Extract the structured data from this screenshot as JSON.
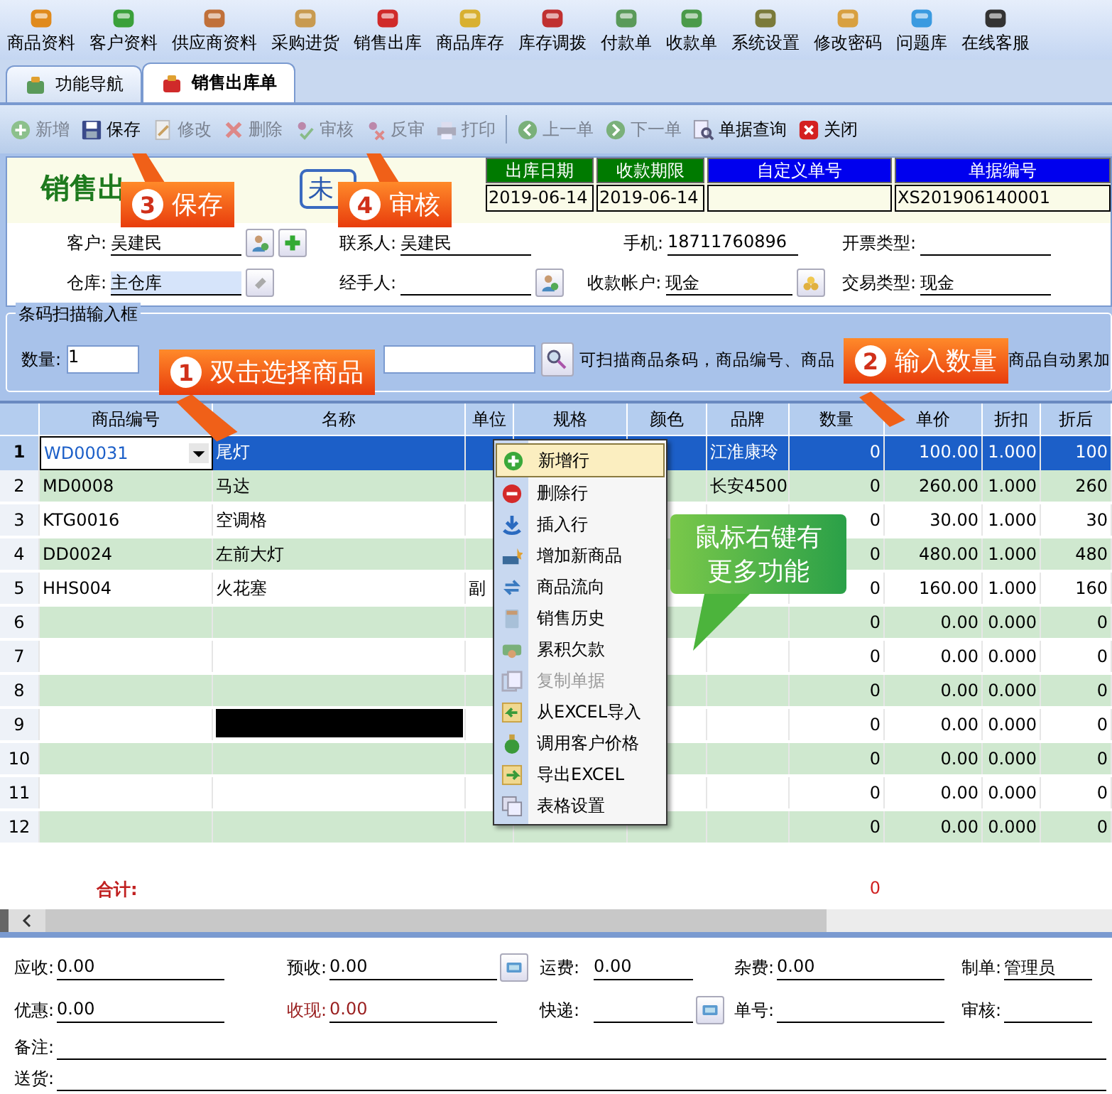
{
  "menu_bar": [
    "商品资料",
    "客户资料",
    "供应商资料",
    "采购进货",
    "销售出库",
    "商品库存",
    "库存调拨",
    "付款单",
    "收款单",
    "系统设置",
    "修改密码",
    "问题库",
    "在线客服"
  ],
  "tabs": [
    {
      "label": "功能导航",
      "selected": false
    },
    {
      "label": "销售出库单",
      "selected": true
    }
  ],
  "toolbar": [
    {
      "label": "新增",
      "kind": "plus",
      "disabled": true
    },
    {
      "label": "保存",
      "kind": "disk",
      "disabled": false
    },
    {
      "label": "修改",
      "kind": "pencil",
      "disabled": true
    },
    {
      "label": "删除",
      "kind": "cross",
      "disabled": true
    },
    {
      "label": "审核",
      "kind": "check",
      "disabled": true
    },
    {
      "label": "反审",
      "kind": "uncheck",
      "disabled": true
    },
    {
      "label": "打印",
      "kind": "printer",
      "disabled": true
    },
    {
      "label": "上一单",
      "kind": "left",
      "disabled": true
    },
    {
      "label": "下一单",
      "kind": "right",
      "disabled": true
    },
    {
      "label": "单据查询",
      "kind": "search",
      "disabled": false
    },
    {
      "label": "关闭",
      "kind": "close",
      "disabled": false
    }
  ],
  "form_title": "销售出",
  "stamp": "未",
  "header_fields": [
    {
      "label": "出库日期",
      "value": "2019-06-14",
      "color": "#007a00"
    },
    {
      "label": "收款期限",
      "value": "2019-06-14",
      "color": "#007a00"
    },
    {
      "label": "自定义单号",
      "color": "#0000ee"
    },
    {
      "label": "单据编号",
      "value": "XS201906140001",
      "color": "#0000ee"
    }
  ],
  "form_rows": [
    [
      {
        "label": "客户:",
        "value": "吴建民",
        "focused": false,
        "kind": "customer"
      },
      {
        "label": "联系人:",
        "value": "吴建民",
        "focused": false,
        "kind": "plain"
      },
      {
        "label": "手机:",
        "value": "18711760896",
        "focused": false,
        "kind": "plain"
      },
      {
        "label": "开票类型:",
        "focused": false,
        "kind": "plain"
      }
    ],
    [
      {
        "label": "仓库:",
        "value": "主仓库",
        "focused": true,
        "kind": "warehouse"
      },
      {
        "label": "经手人:",
        "focused": false,
        "kind": "staff"
      },
      {
        "label": "收款帐户:",
        "value": "现金",
        "focused": false,
        "kind": "account"
      },
      {
        "label": "交易类型:",
        "value": "现金",
        "focused": false,
        "kind": "plain"
      }
    ]
  ],
  "barcode": {
    "legend": "条码扫描输入框",
    "quantity_label": "数量:",
    "quantity": "1",
    "hint_parts": [
      "可扫描商品条码，商品编号、商品",
      "商品自动累加"
    ]
  },
  "table": {
    "columns": [
      {
        "kind": "index"
      },
      {
        "label": "商品编号",
        "kind": "text"
      },
      {
        "label": "名称",
        "kind": "text"
      },
      {
        "label": "单位",
        "kind": "text"
      },
      {
        "label": "规格",
        "kind": "text"
      },
      {
        "label": "颜色",
        "kind": "text"
      },
      {
        "label": "品牌",
        "kind": "text"
      },
      {
        "label": "数量",
        "kind": "number"
      },
      {
        "label": "单价",
        "kind": "number"
      },
      {
        "label": "折扣",
        "kind": "number"
      },
      {
        "label": "折后",
        "kind": "number"
      }
    ],
    "rows": [
      {
        "selected": true,
        "redacted": false,
        "no": "1",
        "code": "WD00031",
        "name": "尾灯",
        "brand": "江淮康玲",
        "qty": "0",
        "price": "100.00",
        "discount": "1.000",
        "net": "100"
      },
      {
        "selected": false,
        "redacted": false,
        "no": "2",
        "code": "MD0008",
        "name": "马达",
        "brand": "长安4500",
        "qty": "0",
        "price": "260.00",
        "discount": "1.000",
        "net": "260"
      },
      {
        "selected": false,
        "redacted": false,
        "no": "3",
        "code": "KTG0016",
        "name": "空调格",
        "qty": "0",
        "price": "30.00",
        "discount": "1.000",
        "net": "30"
      },
      {
        "selected": false,
        "redacted": false,
        "no": "4",
        "code": "DD0024",
        "name": "左前大灯",
        "qty": "0",
        "price": "480.00",
        "discount": "1.000",
        "net": "480"
      },
      {
        "selected": false,
        "redacted": false,
        "no": "5",
        "code": "HHS004",
        "name": "火花塞",
        "unit": "副",
        "qty": "0",
        "price": "160.00",
        "discount": "1.000",
        "net": "160"
      },
      {
        "selected": false,
        "redacted": false,
        "no": "6",
        "qty": "0",
        "price": "0.00",
        "discount": "0.000",
        "net": "0"
      },
      {
        "selected": false,
        "redacted": false,
        "no": "7",
        "qty": "0",
        "price": "0.00",
        "discount": "0.000",
        "net": "0"
      },
      {
        "selected": false,
        "redacted": false,
        "no": "8",
        "qty": "0",
        "price": "0.00",
        "discount": "0.000",
        "net": "0"
      },
      {
        "selected": false,
        "redacted": true,
        "no": "9",
        "qty": "0",
        "price": "0.00",
        "discount": "0.000",
        "net": "0"
      },
      {
        "selected": false,
        "redacted": false,
        "no": "10",
        "qty": "0",
        "price": "0.00",
        "discount": "0.000",
        "net": "0"
      },
      {
        "selected": false,
        "redacted": false,
        "no": "11",
        "qty": "0",
        "price": "0.00",
        "discount": "0.000",
        "net": "0"
      },
      {
        "selected": false,
        "redacted": false,
        "no": "12",
        "qty": "0",
        "price": "0.00",
        "discount": "0.000",
        "net": "0"
      }
    ],
    "total_label": "合计:",
    "total_quantity": "0"
  },
  "context_menu": [
    {
      "label": "新增行",
      "kind": "add",
      "disabled": false,
      "selected": true
    },
    {
      "label": "删除行",
      "kind": "remove",
      "disabled": false,
      "selected": false
    },
    {
      "label": "插入行",
      "kind": "insert",
      "disabled": false,
      "selected": false
    },
    {
      "label": "增加新商品",
      "kind": "goods",
      "disabled": false,
      "selected": false
    },
    {
      "label": "商品流向",
      "kind": "flow",
      "disabled": false,
      "selected": false
    },
    {
      "label": "销售历史",
      "kind": "history",
      "disabled": false,
      "selected": false
    },
    {
      "label": "累积欠款",
      "kind": "debt",
      "disabled": false,
      "selected": false
    },
    {
      "label": "复制单据",
      "kind": "copy",
      "disabled": true,
      "selected": false
    },
    {
      "label": "从EXCEL导入",
      "kind": "import",
      "disabled": false,
      "selected": false
    },
    {
      "label": "调用客户价格",
      "kind": "price",
      "disabled": false,
      "selected": false
    },
    {
      "label": "导出EXCEL",
      "kind": "export",
      "disabled": false,
      "selected": false
    },
    {
      "label": "表格设置",
      "kind": "grid",
      "disabled": false,
      "selected": false
    }
  ],
  "footer_rows": [
    [
      {
        "label": "应收:",
        "value": "0.00",
        "alert": false,
        "kind": "plain"
      },
      {
        "label": "预收:",
        "value": "0.00",
        "alert": false,
        "kind": "lookup"
      },
      {
        "label": "运费:",
        "value": "0.00",
        "alert": false,
        "kind": "plain"
      },
      {
        "label": "杂费:",
        "value": "0.00",
        "alert": false,
        "kind": "plain"
      },
      {
        "label": "制单:",
        "value": "管理员",
        "alert": false,
        "kind": "plain"
      }
    ],
    [
      {
        "label": "优惠:",
        "value": "0.00",
        "alert": false,
        "kind": "plain"
      },
      {
        "label": "收现:",
        "value": "0.00",
        "alert": true,
        "kind": "plain"
      },
      {
        "label": "快递:",
        "alert": false,
        "kind": "lookup"
      },
      {
        "label": "单号:",
        "alert": false,
        "kind": "plain"
      },
      {
        "label": "审核:",
        "alert": false,
        "kind": "plain"
      }
    ]
  ],
  "footer_lines": [
    "备注:",
    "送货:"
  ],
  "callouts": [
    {
      "number": "3",
      "label": "保存",
      "kind": "save"
    },
    {
      "number": "4",
      "label": "审核",
      "kind": "audit"
    },
    {
      "number": "1",
      "label": "双击选择商品",
      "kind": "pick"
    },
    {
      "number": "2",
      "label": "输入数量",
      "kind": "qty"
    }
  ],
  "bubble": [
    "鼠标右键有",
    "更多功能"
  ]
}
